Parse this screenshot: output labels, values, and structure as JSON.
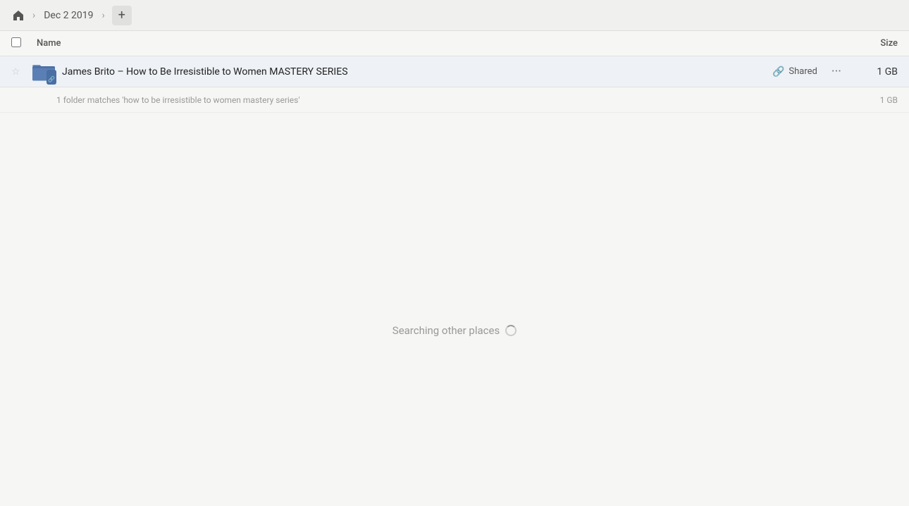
{
  "breadcrumb": {
    "home_label": "Home",
    "date_label": "Dec 2 2019",
    "add_label": "+"
  },
  "columns": {
    "name_label": "Name",
    "size_label": "Size"
  },
  "file_row": {
    "name": "James Brito – How to Be Irresistible to Women MASTERY SERIES",
    "shared_label": "Shared",
    "size": "1 GB",
    "more_label": "···"
  },
  "match_row": {
    "text": "1 folder matches 'how to be irresistible to women mastery series'",
    "size": "1 GB"
  },
  "searching": {
    "text": "Searching other places"
  }
}
